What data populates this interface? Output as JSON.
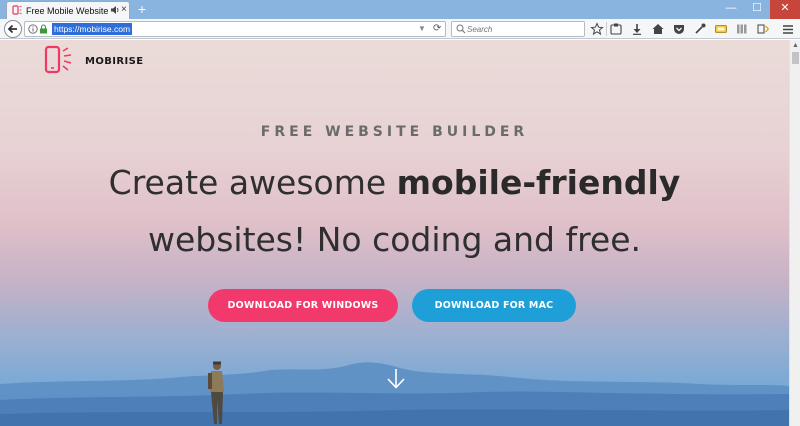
{
  "browser": {
    "tab_title": "Free Mobile Website Bu",
    "new_tab_label": "+",
    "close_tab_label": "×",
    "url": "https://mobirise.com",
    "search_placeholder": "Search",
    "window_controls": {
      "minimize": "—",
      "maximize": "☐",
      "close": "✕"
    },
    "toolbar_icons": [
      "star-icon",
      "reading-list-icon",
      "download-icon",
      "home-icon",
      "pocket-icon",
      "eyedropper-icon",
      "extension-icon",
      "library-icon",
      "sidebar-icon",
      "menu-icon"
    ]
  },
  "page": {
    "logo_text": "MOBIRISE",
    "eyebrow": "FREE WEBSITE BUILDER",
    "headline_line1_light": "Create awesome ",
    "headline_line1_bold": "mobile-friendly",
    "headline_line2": "websites! No coding and free.",
    "download_windows_label": "DOWNLOAD FOR WINDOWS",
    "download_mac_label": "DOWNLOAD FOR MAC"
  },
  "colors": {
    "brand_pink": "#f13a6b",
    "brand_blue": "#1e9fd8",
    "chrome_blue": "#8ab4e0",
    "url_highlight": "#2f6dd8"
  }
}
